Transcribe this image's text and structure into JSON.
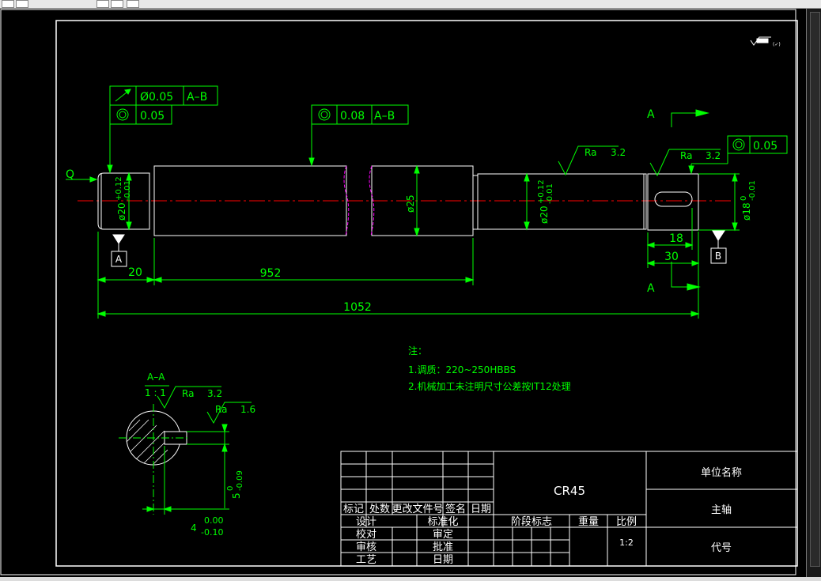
{
  "fcf": {
    "runout_value": "Ø0.05",
    "runout_datum": "A–B",
    "conc_left_value": "0.05",
    "conc_mid_value": "0.08",
    "conc_mid_datum": "A–B",
    "conc_right_value": "0.05"
  },
  "labels": {
    "datum_a": "A",
    "datum_b": "B",
    "section_a_top": "A",
    "section_a_bottom": "A",
    "leader_q": "Q",
    "ra_left": "Ra",
    "ra_left_val": "3.2",
    "ra_right": "Ra",
    "ra_right_val": "3.2"
  },
  "dims": {
    "d20_left": "ø20",
    "d20_left_upper": "+0.12",
    "d20_left_lower": "-0.01",
    "d25": "ø25",
    "d20_right": "ø20",
    "d20_right_upper": "+0.12",
    "d20_right_lower": "-0.01",
    "d18": "ø18",
    "d18_upper": "0",
    "d18_lower": "-0.01",
    "len_20": "20",
    "len_952": "952",
    "len_1052": "1052",
    "len_18": "18",
    "len_30": "30"
  },
  "section": {
    "title": "A–A",
    "scale": "1 : 1",
    "ra1": "Ra",
    "ra1_val": "3.2",
    "ra2": "Ra",
    "ra2_val": "1.6",
    "depth": "5",
    "depth_upper": "0",
    "depth_lower": "-0.09",
    "width": "4",
    "width_upper": "0.00",
    "width_lower": "-0.10"
  },
  "notes": {
    "title": "注：",
    "line1": "1.调质：220~250HBBS",
    "line2": "2.机械加工未注明尺寸公差按IT12处理"
  },
  "title_block": {
    "material": "CR45",
    "company": "单位名称",
    "part_name": "主轴",
    "code": "代号",
    "scale_value": "1:2",
    "h_mark": "标记",
    "h_count": "处数",
    "h_change": "更改文件号",
    "h_sign": "签名",
    "h_date": "日期",
    "r_design": "设计",
    "r_standard": "标准化",
    "r_check": "校对",
    "r_audit": "审定",
    "r_review": "审核",
    "r_approve": "批准",
    "r_process": "工艺",
    "r_date": "日期",
    "stage": "阶段标志",
    "weight": "重量",
    "scale": "比例"
  },
  "colors": {
    "outline": "#ffffff",
    "dimension": "#00ff00",
    "centerline": "#ff0000",
    "break": "#ff00ff",
    "background": "#000000"
  }
}
